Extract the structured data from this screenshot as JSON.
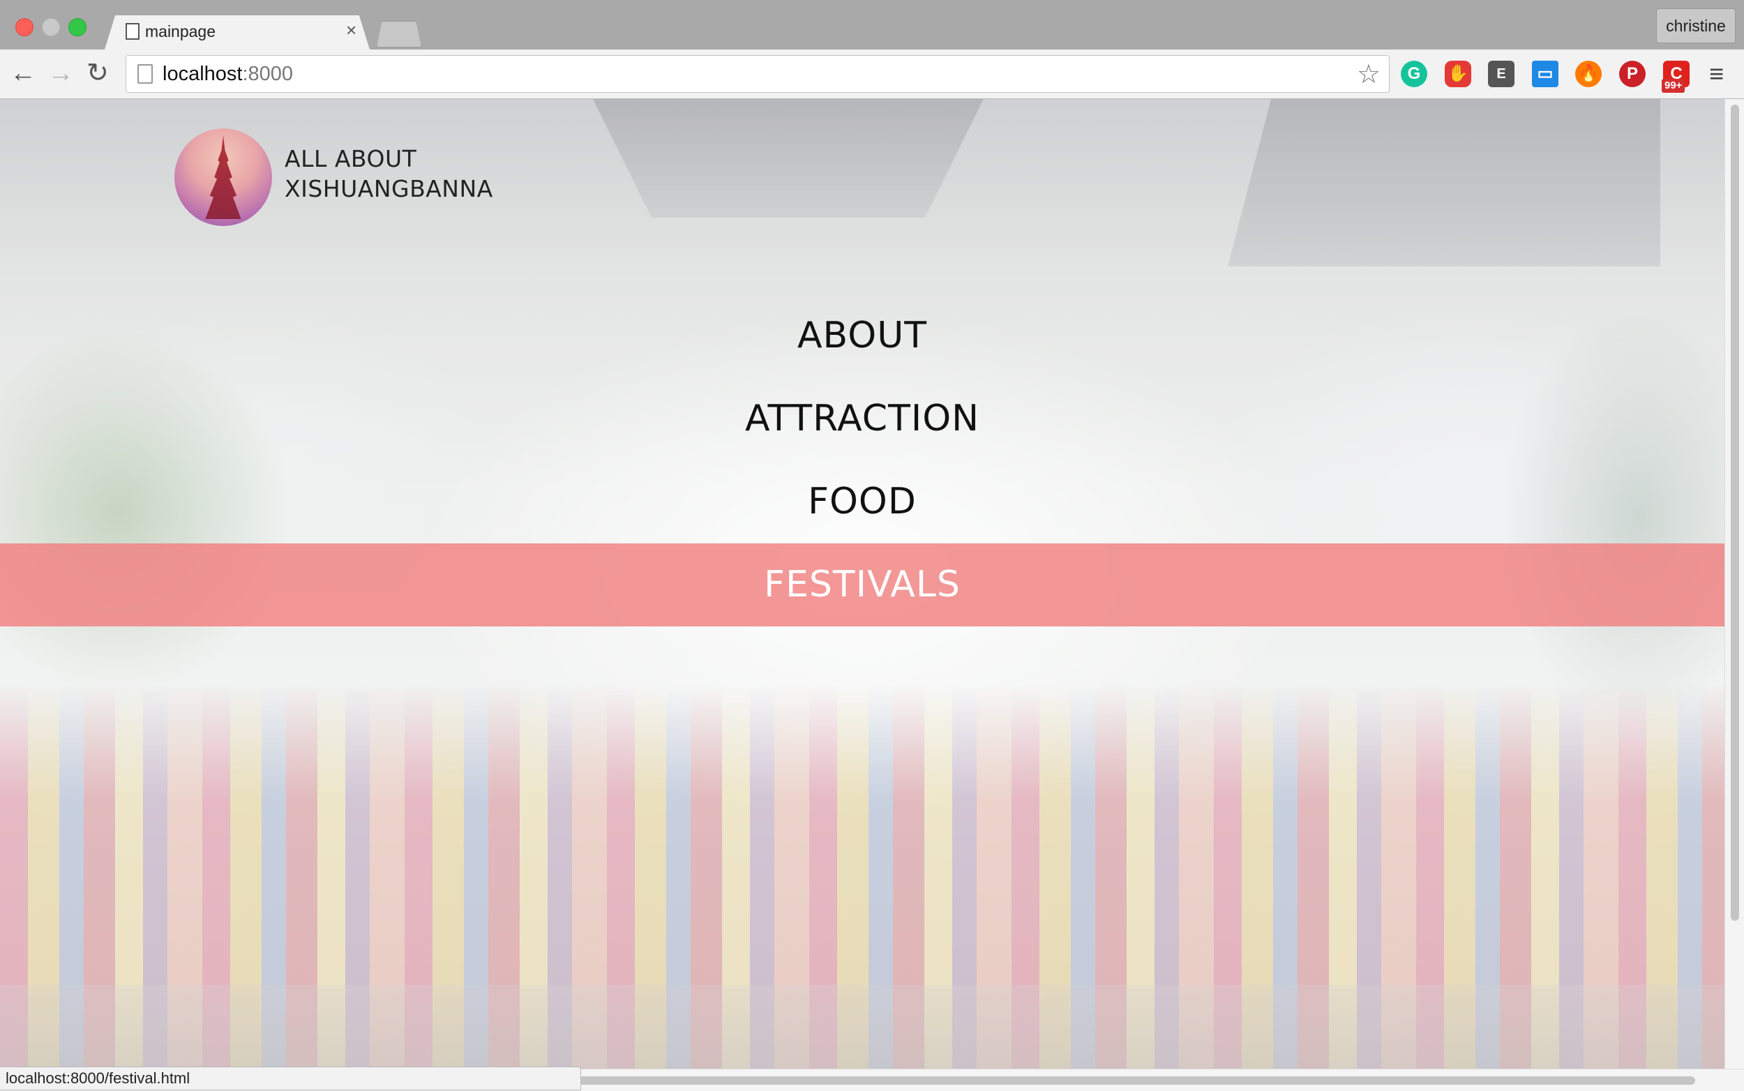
{
  "browser": {
    "tab_title": "mainpage",
    "tab_close": "×",
    "profile_name": "christine",
    "url_host": "localhost",
    "url_port": ":8000",
    "icons": {
      "back": "←",
      "forward": "→",
      "reload": "↻",
      "bookmark": "☆",
      "menu": "≡"
    },
    "extensions": [
      {
        "name": "grammarly",
        "glyph": "G"
      },
      {
        "name": "adblock",
        "glyph": "✋"
      },
      {
        "name": "evernote",
        "glyph": "E"
      },
      {
        "name": "window",
        "glyph": "▭"
      },
      {
        "name": "fire",
        "glyph": "🔥"
      },
      {
        "name": "pinterest",
        "glyph": "P"
      },
      {
        "name": "opera",
        "glyph": "C"
      }
    ],
    "extension_badge": "99+",
    "status_text": "localhost:8000/festival.html"
  },
  "page": {
    "brand": {
      "line1": "ALL ABOUT",
      "line2": "XISHUANGBANNA"
    },
    "menu": {
      "about": "ABOUT",
      "attraction": "ATTRACTION",
      "food": "FOOD",
      "festivals": "FESTIVALS"
    },
    "active_item": "festivals",
    "active_color": "#f08080"
  }
}
